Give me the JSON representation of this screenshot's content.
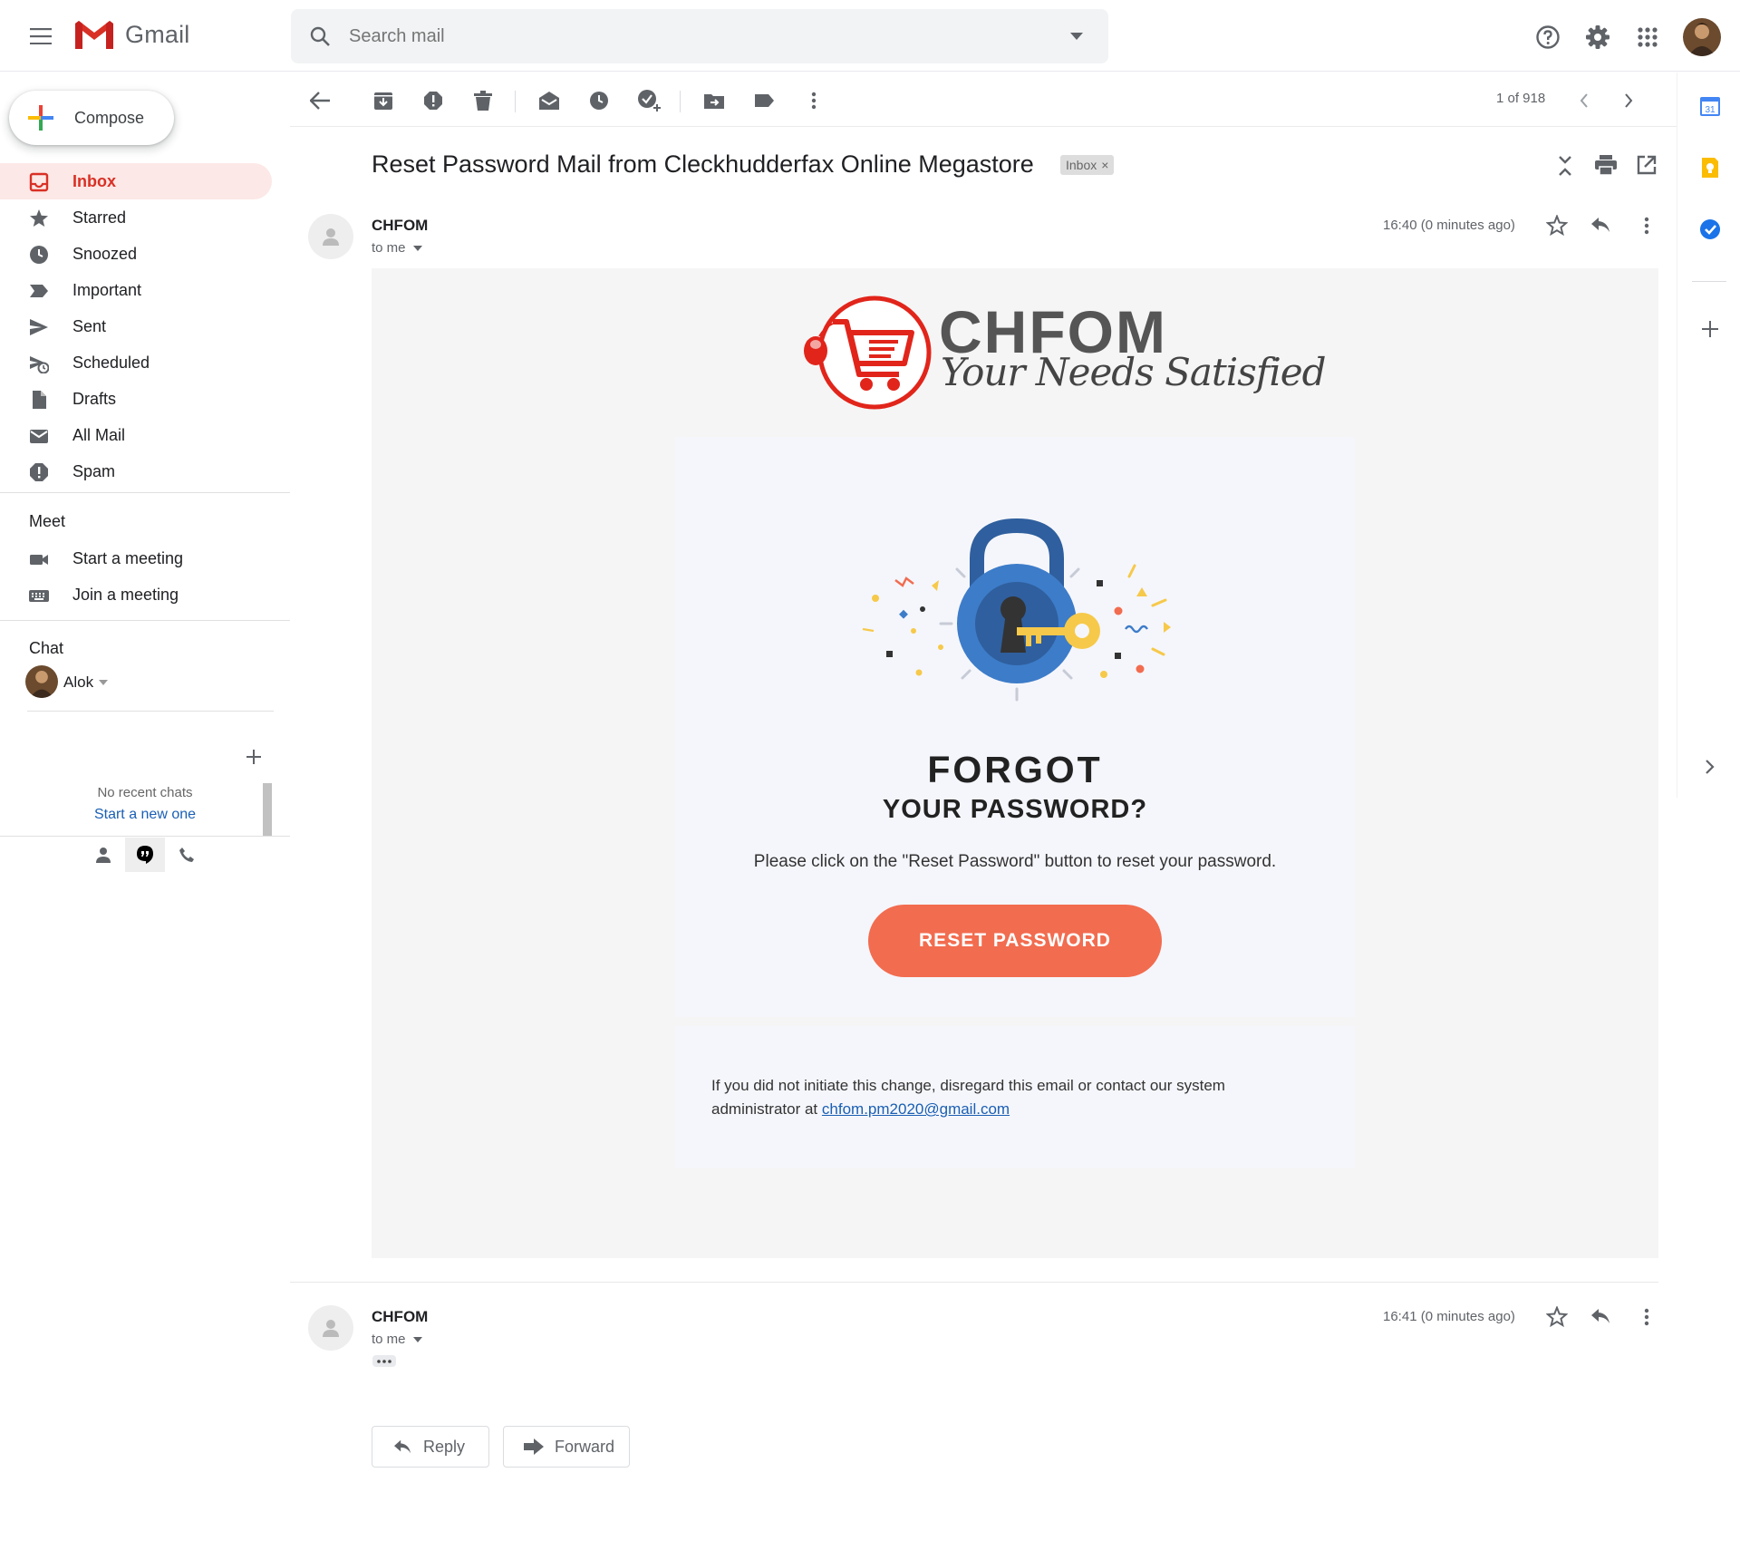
{
  "app": {
    "name": "Gmail"
  },
  "search": {
    "placeholder": "Search mail"
  },
  "compose": {
    "label": "Compose"
  },
  "nav": [
    {
      "label": "Inbox",
      "icon": "inbox-icon",
      "active": true
    },
    {
      "label": "Starred",
      "icon": "star-icon"
    },
    {
      "label": "Snoozed",
      "icon": "clock-icon"
    },
    {
      "label": "Important",
      "icon": "important-icon"
    },
    {
      "label": "Sent",
      "icon": "send-icon"
    },
    {
      "label": "Scheduled",
      "icon": "scheduled-icon"
    },
    {
      "label": "Drafts",
      "icon": "draft-icon"
    },
    {
      "label": "All Mail",
      "icon": "mail-icon"
    },
    {
      "label": "Spam",
      "icon": "spam-icon"
    }
  ],
  "meet": {
    "title": "Meet",
    "items": [
      "Start a meeting",
      "Join a meeting"
    ]
  },
  "chat": {
    "title": "Chat",
    "user": "Alok",
    "empty": "No recent chats",
    "start_new": "Start a new one"
  },
  "toolbar": {
    "page_count": "1 of 918"
  },
  "thread": {
    "subject": "Reset Password Mail from Cleckhudderfax Online Megastore",
    "label": "Inbox"
  },
  "messages": [
    {
      "sender": "CHFOM",
      "to": "to me",
      "time": "16:40 (0 minutes ago)"
    },
    {
      "sender": "CHFOM",
      "to": "to me",
      "time": "16:41 (0 minutes ago)"
    }
  ],
  "email": {
    "brand": "CHFOM",
    "tagline": "Your Needs Satisfied",
    "heading_1": "FORGOT",
    "heading_2": "YOUR PASSWORD?",
    "instruction": "Please click on the \"Reset Password\" button to reset your password.",
    "button": "RESET PASSWORD",
    "disclaimer": "If you did not initiate this change, disregard this email or contact our system administrator at",
    "admin_email": "chfom.pm2020@gmail.com"
  },
  "actions": {
    "reply": "Reply",
    "forward": "Forward"
  },
  "colors": {
    "gmail_red": "#d93025",
    "reset_button": "#f26c4f",
    "lock_blue": "#3d7cc9",
    "key_yellow": "#f6c94a"
  }
}
